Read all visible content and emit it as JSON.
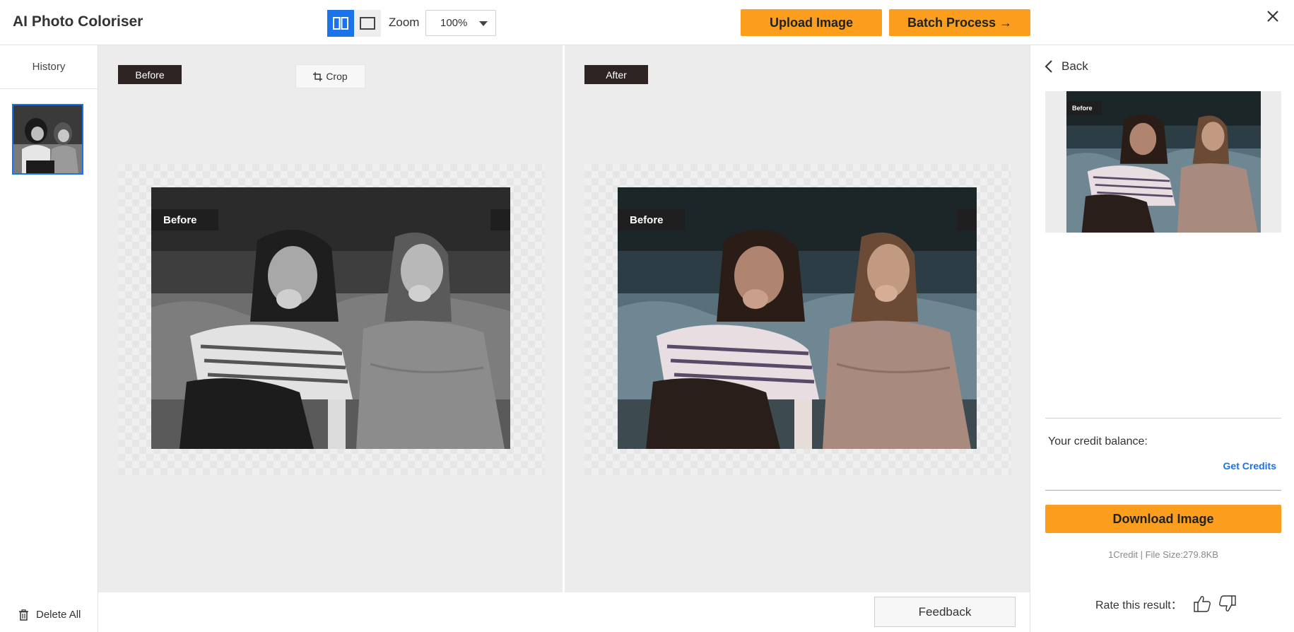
{
  "header": {
    "title": "AI Photo Coloriser",
    "zoom_label": "Zoom",
    "zoom_value": "100%",
    "upload_label": "Upload Image",
    "batch_label": "Batch Process →"
  },
  "sidebar": {
    "history_label": "History",
    "delete_all_label": "Delete All"
  },
  "compare": {
    "before_tag": "Before",
    "after_tag": "After",
    "crop_label": "Crop",
    "before_image_label": "Before",
    "after_image_label": "Before"
  },
  "footer": {
    "feedback_label": "Feedback"
  },
  "right_panel": {
    "back_label": "Back",
    "preview_label": "Before",
    "credit_label": "Your credit balance:",
    "get_credits_label": "Get Credits",
    "download_label": "Download Image",
    "file_info": "1Credit | File Size:279.8KB",
    "rate_label": "Rate this result："
  },
  "colors": {
    "accent_orange": "#fb9e1d",
    "accent_blue": "#1a73e8"
  }
}
